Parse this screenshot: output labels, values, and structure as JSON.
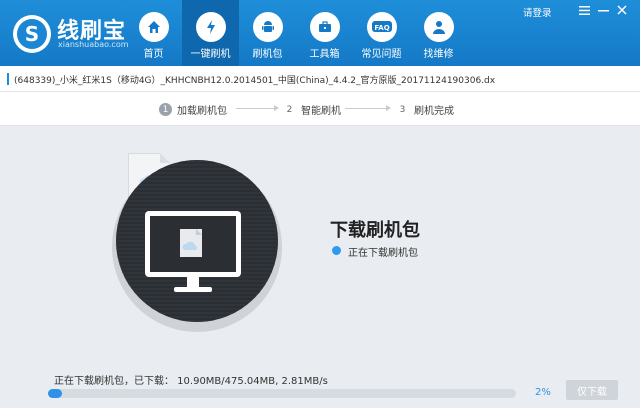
{
  "app": {
    "title": "线刷宝",
    "subtitle": "xianshuabao.com"
  },
  "nav": [
    {
      "label": "首页",
      "icon": "home-icon",
      "active": false
    },
    {
      "label": "一键刷机",
      "icon": "lightning-icon",
      "active": true
    },
    {
      "label": "刷机包",
      "icon": "android-icon",
      "active": false
    },
    {
      "label": "工具箱",
      "icon": "toolbox-icon",
      "active": false
    },
    {
      "label": "常见问题",
      "icon": "faq-icon",
      "active": false
    },
    {
      "label": "找维修",
      "icon": "person-icon",
      "active": false
    }
  ],
  "top_right": {
    "login": "请登录",
    "window_controls": [
      "menu-icon",
      "minimize-icon",
      "close-icon"
    ]
  },
  "file": {
    "name": "(648339)_小米_红米1S（移动4G）_KHHCNBH12.0.2014501_中国(China)_4.4.2_官方原版_20171124190306.dx"
  },
  "steps": [
    {
      "num": "1",
      "label": "加载刷机包"
    },
    {
      "num": "2",
      "label": "智能刷机"
    },
    {
      "num": "3",
      "label": "刷机完成"
    }
  ],
  "status": {
    "title": "下载刷机包",
    "detail": "正在下载刷机包"
  },
  "progress": {
    "text": "正在下载刷机包，已下载：  10.90MB/475.04MB,  2.81MB/s",
    "percent_label": "2%",
    "percent": 2,
    "button_label": "仅下载"
  },
  "colors": {
    "header": "#1479c6",
    "accent": "#2e93e8"
  }
}
